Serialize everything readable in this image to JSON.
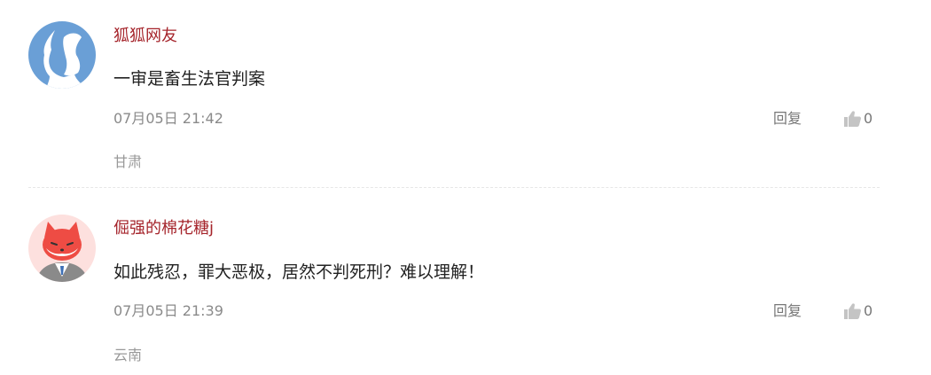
{
  "comments": [
    {
      "username": "狐狐网友",
      "content": "一审是畜生法官判案",
      "time": "07月05日 21:42",
      "reply_label": "回复",
      "like_count": "0",
      "location": "甘肃",
      "avatar": "blue-default-avatar"
    },
    {
      "username": "倔强的棉花糖j",
      "content": "如此残忍，罪大恶极，居然不判死刑？难以理解！",
      "time": "07月05日 21:39",
      "reply_label": "回复",
      "like_count": "0",
      "location": "云南",
      "avatar": "fox-avatar"
    }
  ],
  "colors": {
    "username": "#a5242b",
    "meta": "#8a8a8a",
    "avatar_blue": "#6a9fd6",
    "fox_red": "#ee4c44",
    "fox_bg": "#fde0de"
  },
  "icons": {
    "like": "thumbs-up-icon"
  }
}
